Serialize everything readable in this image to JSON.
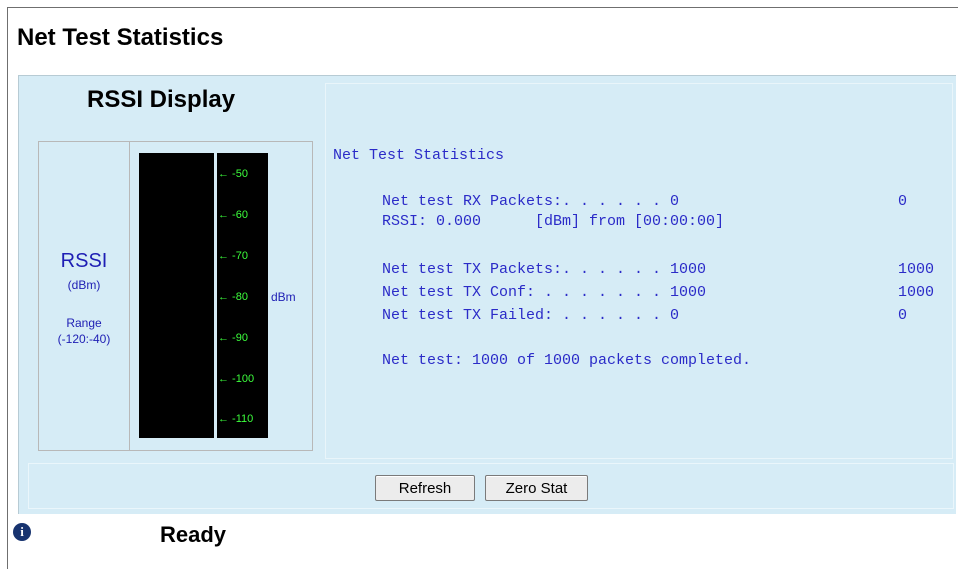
{
  "page": {
    "title": "Net Test Statistics"
  },
  "rssi": {
    "title": "RSSI Display",
    "label": "RSSI",
    "unit": "(dBm)",
    "range_label": "Range",
    "range_value": "(-120:-40)",
    "scale_unit": "dBm",
    "ticks": [
      "← -50",
      "← -60",
      "← -70",
      "← -80",
      "← -90",
      "← -100",
      "← -110"
    ]
  },
  "stats": {
    "heading": "Net Test Statistics",
    "rx_line": "Net test RX Packets:. . . . . . 0",
    "rx_value": "0",
    "rssi_line": "RSSI: 0.000      [dBm] from [00:00:00]",
    "tx_line": "Net test TX Packets:. . . . . . 1000",
    "tx_value": "1000",
    "conf_line": "Net test TX Conf: . . . . . . . 1000",
    "conf_value": "1000",
    "failed_line": "Net test TX Failed: . . . . . . 0",
    "failed_value": "0",
    "summary": "Net test: 1000 of 1000 packets completed."
  },
  "buttons": {
    "refresh": "Refresh",
    "zero_stat": "Zero Stat"
  },
  "status": {
    "icon": "info-icon",
    "text": "Ready"
  }
}
